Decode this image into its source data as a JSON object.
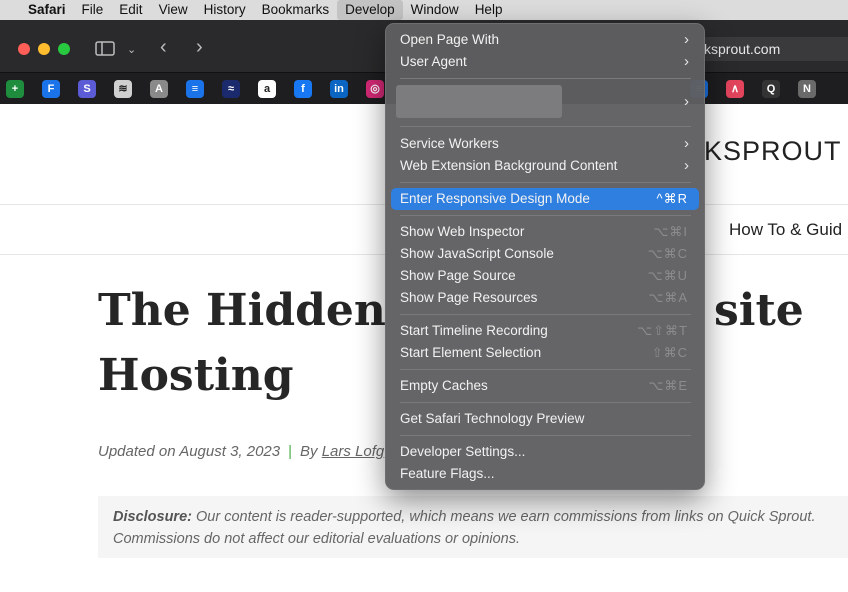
{
  "menubar": {
    "app": "Safari",
    "items": [
      "File",
      "Edit",
      "View",
      "History",
      "Bookmarks",
      "Develop",
      "Window",
      "Help"
    ],
    "active": "Develop"
  },
  "toolbar": {
    "url": "ksprout.com"
  },
  "favorites": [
    {
      "icon": "sheets-icon",
      "glyph": "+",
      "color": "#1e8e3e"
    },
    {
      "icon": "forms-icon",
      "glyph": "F",
      "color": "#1a73e8"
    },
    {
      "icon": "s-app-icon",
      "glyph": "S",
      "color": "#5b5bd6"
    },
    {
      "icon": "stack-icon",
      "glyph": "≋",
      "color": "#d0d0d0"
    },
    {
      "icon": "a-letter-icon",
      "glyph": "A",
      "color": "#8a8a8a"
    },
    {
      "icon": "docs-icon",
      "glyph": "≡",
      "color": "#1a73e8"
    },
    {
      "icon": "waves-icon",
      "glyph": "≈",
      "color": "#1a2a6c"
    },
    {
      "icon": "amazon-icon",
      "glyph": "a",
      "color": "#ffffff"
    },
    {
      "icon": "facebook-icon",
      "glyph": "f",
      "color": "#1877f2"
    },
    {
      "icon": "linkedin-icon",
      "glyph": "in",
      "color": "#0a66c2"
    },
    {
      "icon": "instagram-icon",
      "glyph": "◎",
      "color": "#d62976"
    },
    {
      "icon": "docs-icon-2",
      "glyph": "≡",
      "color": "#1a73e8"
    },
    {
      "icon": "monday-icon",
      "glyph": "∧",
      "color": "#e2445c"
    },
    {
      "icon": "quora-icon",
      "glyph": "Q",
      "color": "#333333"
    },
    {
      "icon": "notion-icon",
      "glyph": "N",
      "color": "#6a6a6a"
    }
  ],
  "page": {
    "logo": "KSPROUT",
    "nav_link": "How To & Guid",
    "title_line1": "The Hidden",
    "title_line1_end": "site",
    "title_line2": "Hosting",
    "updated_prefix": "Updated on",
    "updated_date": "August 3, 2023",
    "separator": "|",
    "by": "By",
    "author": "Lars Lofg",
    "disclosure_label": "Disclosure:",
    "disclosure_text": " Our content is reader-supported, which means we earn commissions from links on Quick Sprout. Commissions do not affect our editorial evaluations or opinions."
  },
  "develop_menu": {
    "items": [
      {
        "label": "Open Page With",
        "submenu": true
      },
      {
        "label": "User Agent",
        "submenu": true
      },
      {
        "label": "",
        "submenu": true,
        "redacted": true
      },
      {
        "label": "Service Workers",
        "submenu": true
      },
      {
        "label": "Web Extension Background Content",
        "submenu": true
      },
      {
        "label": "Enter Responsive Design Mode",
        "shortcut": "^⌘R",
        "highlighted": true
      },
      {
        "label": "Show Web Inspector",
        "shortcut": "⌥⌘I"
      },
      {
        "label": "Show JavaScript Console",
        "shortcut": "⌥⌘C"
      },
      {
        "label": "Show Page Source",
        "shortcut": "⌥⌘U"
      },
      {
        "label": "Show Page Resources",
        "shortcut": "⌥⌘A"
      },
      {
        "label": "Start Timeline Recording",
        "shortcut": "⌥⇧⌘T"
      },
      {
        "label": "Start Element Selection",
        "shortcut": "⇧⌘C"
      },
      {
        "label": "Empty Caches",
        "shortcut": "⌥⌘E"
      },
      {
        "label": "Get Safari Technology Preview"
      },
      {
        "label": "Developer Settings..."
      },
      {
        "label": "Feature Flags..."
      }
    ],
    "submenu_arrow": "›"
  },
  "colors": {
    "menu_highlight": "#2f7fe0",
    "close": "#ff5f57",
    "minimize": "#febc2e",
    "zoom": "#28c840"
  }
}
